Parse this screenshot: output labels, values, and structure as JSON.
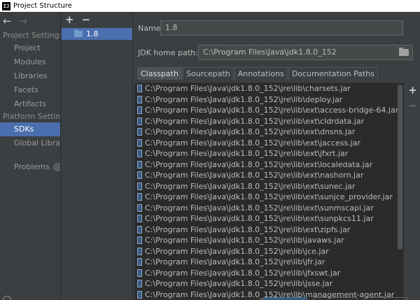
{
  "window": {
    "title": "Project Structure",
    "icon_letter": "IJ"
  },
  "nav": {
    "back_icon": "←",
    "forward_icon": "→",
    "project_settings_header": "Project Settings",
    "project_settings_items": [
      "Project",
      "Modules",
      "Libraries",
      "Facets",
      "Artifacts"
    ],
    "platform_settings_header": "Platform Settings",
    "platform_items": [
      "SDKs",
      "Global Libraries"
    ],
    "selected": "SDKs",
    "problems": "Problems"
  },
  "sdk_list": {
    "add_icon": "+",
    "remove_icon": "−",
    "entries": [
      "1.8"
    ]
  },
  "details": {
    "name_label": "Name:",
    "name_value": "1.8",
    "jdk_home_label": "JDK home path:",
    "jdk_home_value": "C:\\Program Files\\Java\\jdk1.8.0_152",
    "tabs": [
      "Classpath",
      "Sourcepath",
      "Annotations",
      "Documentation Paths"
    ],
    "active_tab": "Classpath",
    "classpath": [
      "C:\\Program Files\\Java\\jdk1.8.0_152\\jre\\lib\\charsets.jar",
      "C:\\Program Files\\Java\\jdk1.8.0_152\\jre\\lib\\deploy.jar",
      "C:\\Program Files\\Java\\jdk1.8.0_152\\jre\\lib\\ext\\access-bridge-64.jar",
      "C:\\Program Files\\Java\\jdk1.8.0_152\\jre\\lib\\ext\\cldrdata.jar",
      "C:\\Program Files\\Java\\jdk1.8.0_152\\jre\\lib\\ext\\dnsns.jar",
      "C:\\Program Files\\Java\\jdk1.8.0_152\\jre\\lib\\ext\\jaccess.jar",
      "C:\\Program Files\\Java\\jdk1.8.0_152\\jre\\lib\\ext\\jfxrt.jar",
      "C:\\Program Files\\Java\\jdk1.8.0_152\\jre\\lib\\ext\\localedata.jar",
      "C:\\Program Files\\Java\\jdk1.8.0_152\\jre\\lib\\ext\\nashorn.jar",
      "C:\\Program Files\\Java\\jdk1.8.0_152\\jre\\lib\\ext\\sunec.jar",
      "C:\\Program Files\\Java\\jdk1.8.0_152\\jre\\lib\\ext\\sunjce_provider.jar",
      "C:\\Program Files\\Java\\jdk1.8.0_152\\jre\\lib\\ext\\sunmscapi.jar",
      "C:\\Program Files\\Java\\jdk1.8.0_152\\jre\\lib\\ext\\sunpkcs11.jar",
      "C:\\Program Files\\Java\\jdk1.8.0_152\\jre\\lib\\ext\\zipfs.jar",
      "C:\\Program Files\\Java\\jdk1.8.0_152\\jre\\lib\\javaws.jar",
      "C:\\Program Files\\Java\\jdk1.8.0_152\\jre\\lib\\jce.jar",
      "C:\\Program Files\\Java\\jdk1.8.0_152\\jre\\lib\\jfr.jar",
      "C:\\Program Files\\Java\\jdk1.8.0_152\\jre\\lib\\jfxswt.jar",
      "C:\\Program Files\\Java\\jdk1.8.0_152\\jre\\lib\\jsse.jar",
      "C:\\Program Files\\Java\\jdk1.8.0_152\\jre\\lib\\management-agent.jar"
    ],
    "add_path_icon": "+",
    "remove_path_icon": "−"
  },
  "colors": {
    "background": "#3c3f41",
    "list_background": "#2b2b2b",
    "selection": "#4b6eaf",
    "text": "#bbbbbb"
  }
}
